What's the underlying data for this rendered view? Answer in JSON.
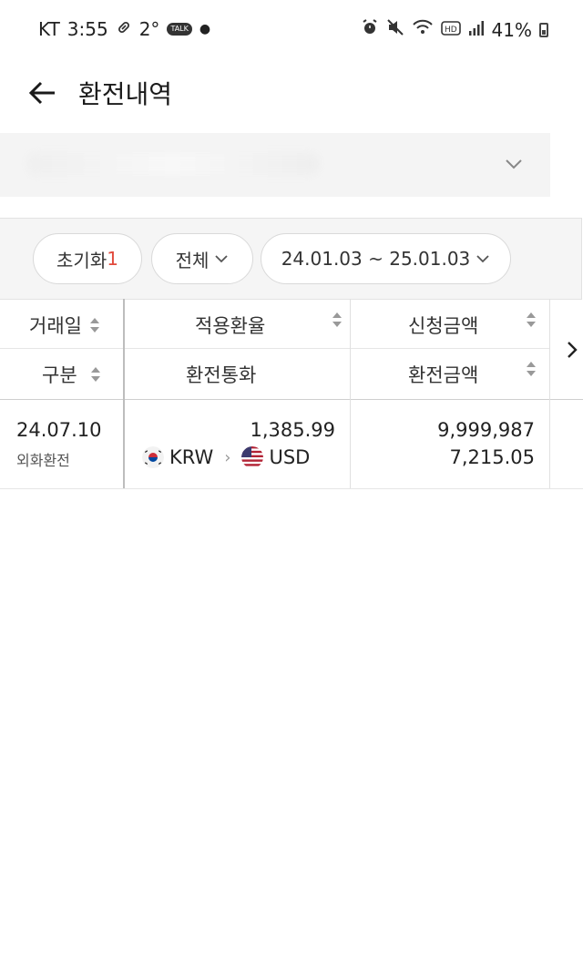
{
  "status_bar": {
    "carrier": "KT",
    "time": "3:55",
    "temperature": "2°",
    "talk_badge": "TALK",
    "battery": "41%",
    "icons_left": [
      "pill-icon",
      "kakaotalk-icon",
      "dot-icon"
    ],
    "icons_right": [
      "alarm-icon",
      "mute-icon",
      "wifi-icon",
      "hd-icon",
      "signal-icon",
      "battery-icon"
    ]
  },
  "header": {
    "title": "환전내역"
  },
  "filters": {
    "reset_label": "초기화",
    "reset_count": "1",
    "type_label": "전체",
    "date_range": "24.01.03 ~ 25.01.03"
  },
  "table": {
    "headers": {
      "date": "거래일",
      "rate": "적용환율",
      "request_amount": "신청금액",
      "category": "구분",
      "currency": "환전통화",
      "exchange_amount": "환전금액"
    },
    "rows": [
      {
        "date": "24.07.10",
        "type": "외화환전",
        "rate": "1,385.99",
        "from_currency": "KRW",
        "to_currency": "USD",
        "request_amount": "9,999,987",
        "exchange_amount": "7,215.05"
      }
    ]
  },
  "colors": {
    "accent_red": "#e14a3d",
    "border": "#d9d9d9",
    "filter_bg": "#f5f5f5"
  }
}
